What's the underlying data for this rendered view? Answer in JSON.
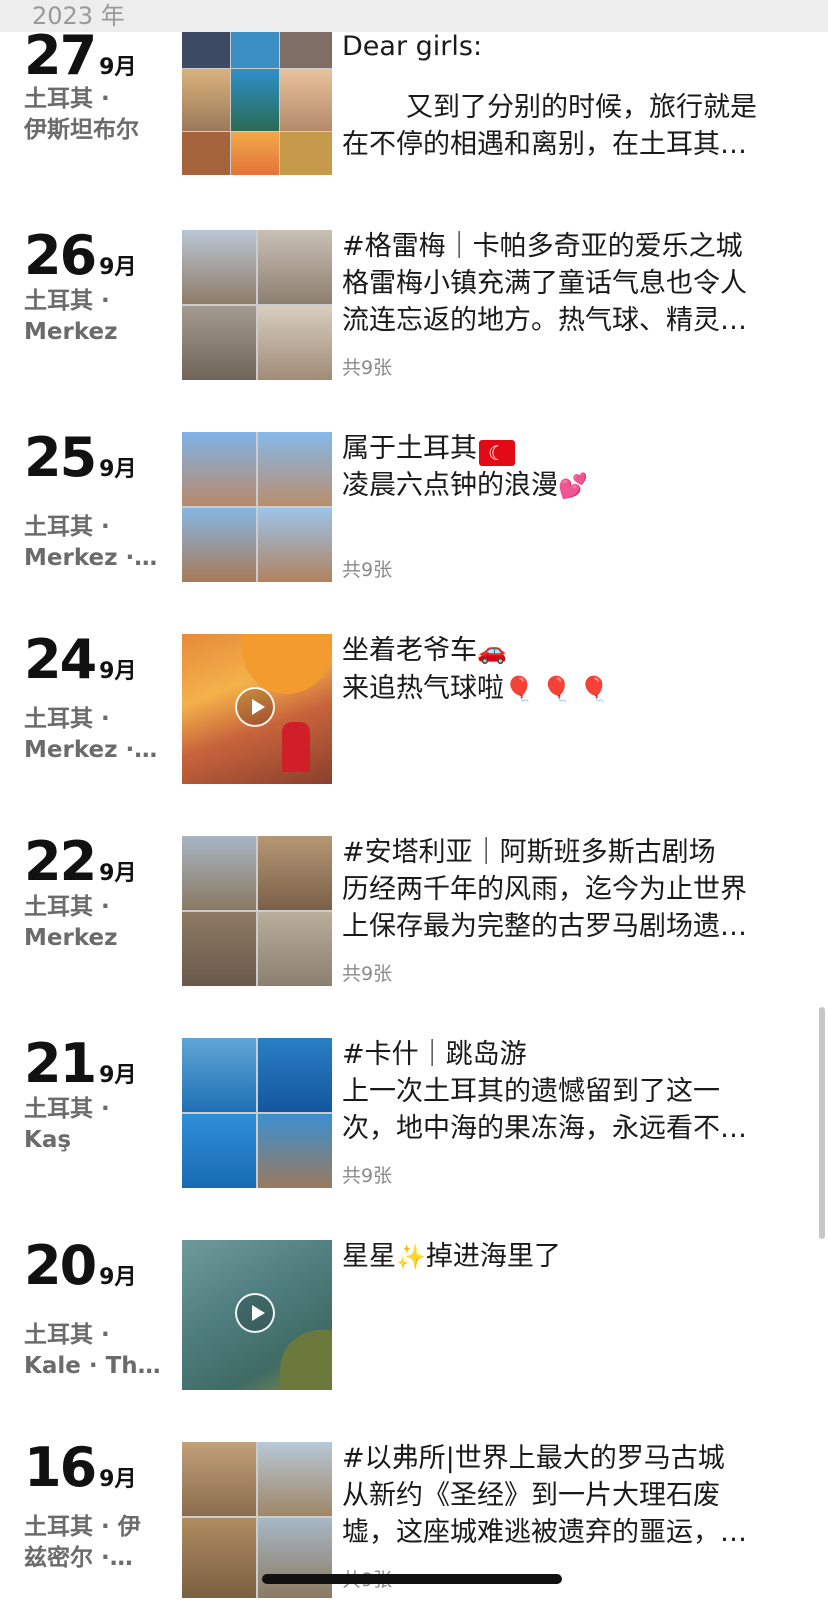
{
  "header": {
    "year": "2023 年"
  },
  "entries": [
    {
      "day": "27",
      "month": "9月",
      "loc1": "土耳其 ·",
      "loc2": "伊斯坦布尔",
      "line1": "Dear girls:",
      "line2": "",
      "line3": "又到了分别的时候，旅行就是",
      "line4": "在不停的相遇和离别，在土耳其…",
      "media": "collage"
    },
    {
      "day": "26",
      "month": "9月",
      "loc1": "土耳其 ·",
      "loc2": "Merkez",
      "line1": "#格雷梅｜卡帕多奇亚的爱乐之城",
      "line2": "格雷梅小镇充满了童话气息也令人",
      "line3": "流连忘返的地方。热气球、精灵…",
      "count": "共9张",
      "media": "grid"
    },
    {
      "day": "25",
      "month": "9月",
      "loc1": "土耳其 ·",
      "loc2": "Merkez ·…",
      "line1": "属于土耳其",
      "line2": "凌晨六点钟的浪漫",
      "flag_icon": "turkey-flag-icon",
      "heart_icon": "heart-icon",
      "count": "共9张",
      "media": "grid"
    },
    {
      "day": "24",
      "month": "9月",
      "loc1": "土耳其 ·",
      "loc2": "Merkez ·…",
      "line1": "坐着老爷车",
      "line2": "来追热气球啦",
      "car_icon": "car-icon",
      "balloon_icon": "balloon-icon",
      "media": "video"
    },
    {
      "day": "22",
      "month": "9月",
      "loc1": "土耳其 ·",
      "loc2": "Merkez",
      "line1": "#安塔利亚｜阿斯班多斯古剧场",
      "line2": "历经两千年的风雨，迄今为止世界",
      "line3": "上保存最为完整的古罗马剧场遗…",
      "count": "共9张",
      "media": "grid"
    },
    {
      "day": "21",
      "month": "9月",
      "loc1": "土耳其 ·",
      "loc2": "Kaş",
      "line1": "#卡什｜跳岛游",
      "line2": "上一次土耳其的遗憾留到了这一",
      "line3": "次，地中海的果冻海，永远看不…",
      "count": "共9张",
      "media": "grid"
    },
    {
      "day": "20",
      "month": "9月",
      "loc1": "土耳其 ·",
      "loc2": "Kale · Th…",
      "line1a": "星星",
      "line1b": "掉进海里了",
      "sparkle_icon": "sparkle-icon",
      "media": "video"
    },
    {
      "day": "16",
      "month": "9月",
      "loc1": "土耳其 · 伊",
      "loc2": "兹密尔 ·…",
      "line1": "#以弗所|世界上最大的罗马古城",
      "line2": "从新约《圣经》到一片大理石废",
      "line3": "墟，这座城难逃被遗弃的噩运，…",
      "count": "共9张",
      "media": "grid"
    }
  ],
  "colors": {
    "header_bg": "#ededed",
    "secondary_text": "#6b6b6b",
    "count_text": "#8a8a8a"
  }
}
